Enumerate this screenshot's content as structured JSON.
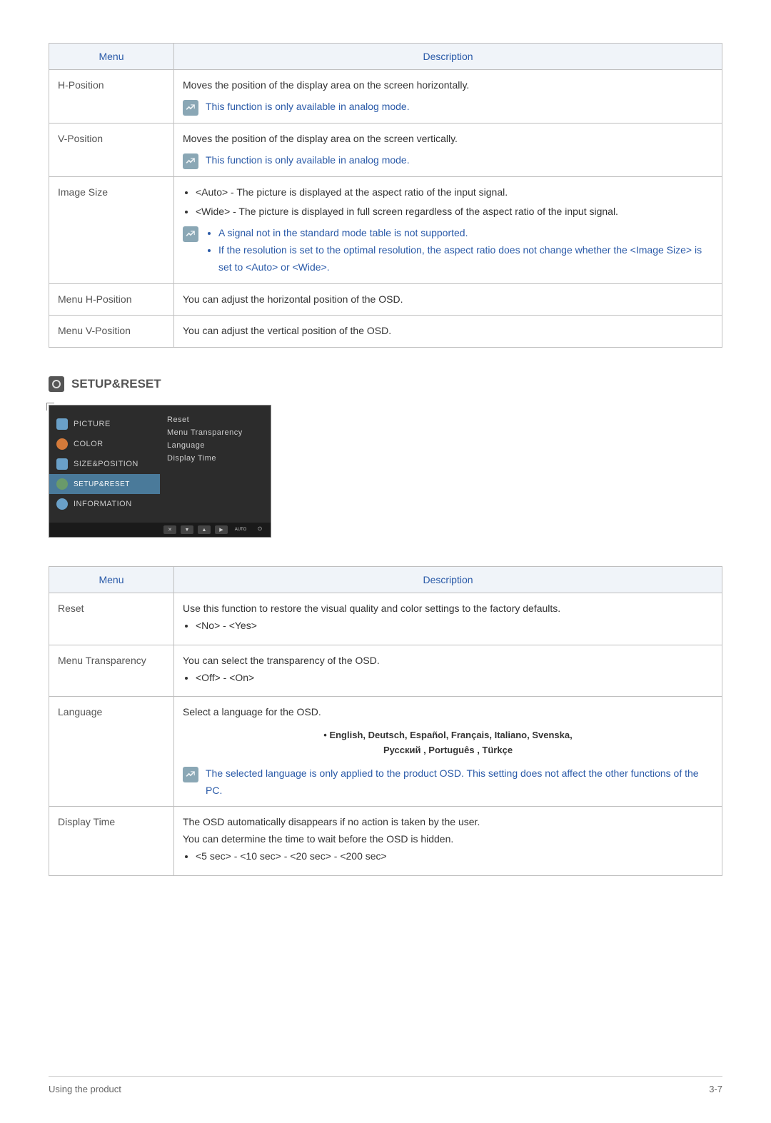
{
  "table1": {
    "headers": {
      "menu": "Menu",
      "desc": "Description"
    },
    "rows": {
      "hpos": {
        "menu": "H-Position",
        "desc": "Moves the position of the display area on the screen horizontally.",
        "note": "This function is only available in analog mode."
      },
      "vpos": {
        "menu": "V-Position",
        "desc": "Moves the position of the display area on the screen vertically.",
        "note": "This function is only available in analog mode."
      },
      "imgsize": {
        "menu": "Image Size",
        "b1": "<Auto> - The picture is displayed at the aspect ratio of the input signal.",
        "b2": "<Wide> - The picture is displayed in full screen regardless of the aspect ratio of the input signal.",
        "n1": "A signal not in the standard mode table is not supported.",
        "n2": "If the resolution is set to the optimal resolution, the aspect ratio does not change whether the <Image Size> is set to <Auto> or <Wide>."
      },
      "menuh": {
        "menu": "Menu H-Position",
        "desc": "You can adjust the horizontal position of the OSD."
      },
      "menuv": {
        "menu": "Menu V-Position",
        "desc": "You can adjust the vertical position of the OSD."
      }
    }
  },
  "section_heading": "SETUP&RESET",
  "osd": {
    "left": {
      "picture": "PICTURE",
      "color": "COLOR",
      "size": "SIZE&POSITION",
      "setup": "SETUP&RESET",
      "info": "INFORMATION"
    },
    "right": {
      "reset": "Reset",
      "trans": "Menu Transparency",
      "lang": "Language",
      "disp": "Display Time"
    },
    "bottom_auto": "AUTO"
  },
  "table2": {
    "headers": {
      "menu": "Menu",
      "desc": "Description"
    },
    "rows": {
      "reset": {
        "menu": "Reset",
        "desc": "Use this function to restore the visual quality and color settings to the factory defaults.",
        "opt": "<No> - <Yes>"
      },
      "trans": {
        "menu": "Menu Transparency",
        "desc": "You can select the transparency of the OSD.",
        "opt": "<Off> - <On>"
      },
      "lang": {
        "menu": "Language",
        "desc": "Select a language for the OSD.",
        "langs1": "• English, Deutsch, Español, Français,  Italiano, Svenska,",
        "langs2": "Русский , Português , Türkçe",
        "note": "The selected language is only applied to the product OSD. This setting does not affect the other functions of the PC."
      },
      "disp": {
        "menu": "Display Time",
        "d1": "The OSD automatically disappears if no action is taken by the user.",
        "d2": "You can determine the time to wait before the OSD is hidden.",
        "opt": "<5 sec> - <10 sec> - <20 sec> - <200 sec>"
      }
    }
  },
  "footer": {
    "left": "Using the product",
    "right": "3-7"
  }
}
